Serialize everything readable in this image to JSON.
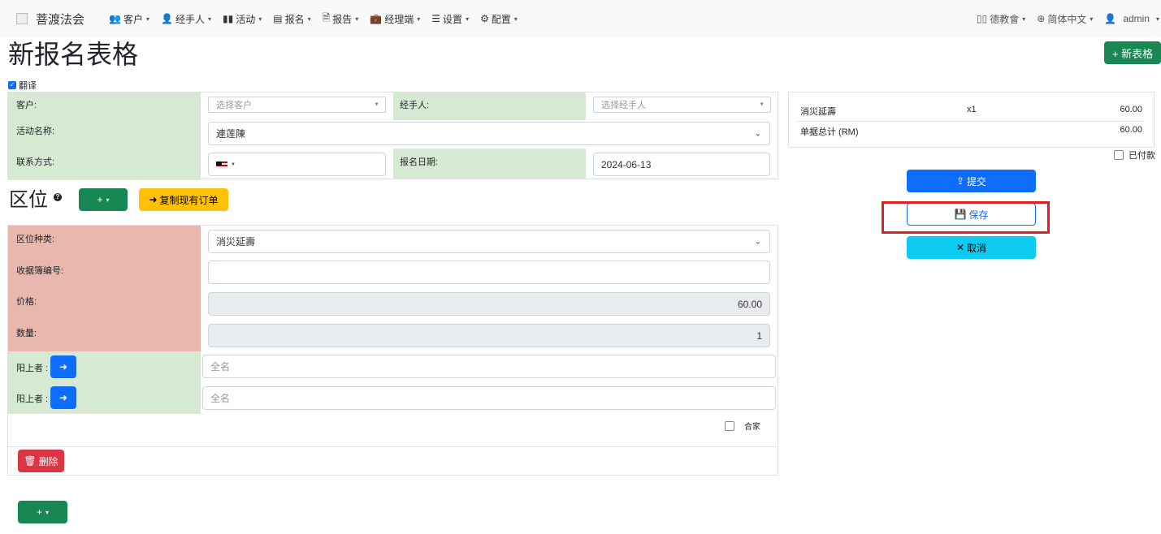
{
  "navbar": {
    "brand": "菩渡法会",
    "items": [
      {
        "icon": "users-icon",
        "glyph": "👥",
        "label": "客户"
      },
      {
        "icon": "user-icon",
        "glyph": "👤",
        "label": "经手人"
      },
      {
        "icon": "book-icon",
        "glyph": "▮▮",
        "label": "活动"
      },
      {
        "icon": "form-icon",
        "glyph": "▤",
        "label": "报名"
      },
      {
        "icon": "report-icon",
        "glyph": "🗎",
        "label": "报告"
      },
      {
        "icon": "briefcase-icon",
        "glyph": "💼",
        "label": "经理端"
      },
      {
        "icon": "sliders-icon",
        "glyph": "☰",
        "label": "设置"
      },
      {
        "icon": "gear-icon",
        "glyph": "⚙",
        "label": "配置"
      }
    ],
    "right": {
      "org_label": "德教會",
      "language_label": "简体中文",
      "user_label": "admin"
    }
  },
  "page": {
    "title": "新报名表格",
    "new_form_label": "+ 新表格",
    "translate_label": "翻译"
  },
  "form": {
    "customer_label": "客户:",
    "customer_placeholder": "选择客户",
    "handler_label": "经手人:",
    "handler_placeholder": "选择经手人",
    "event_label": "活动名称:",
    "event_value": "連莲陳",
    "contact_label": "联系方式:",
    "date_label": "报名日期:",
    "date_value": "2024-06-13"
  },
  "zone": {
    "title": "区位",
    "add_label": "+",
    "copy_label": "复制现有订单",
    "type_label": "区位种类:",
    "type_value": "消災延壽",
    "receipt_label": "收据簿编号:",
    "receipt_value": "",
    "price_label": "价格:",
    "price_value": "60.00",
    "qty_label": "数量:",
    "qty_value": "1",
    "yang_label_1": "阳上者 :",
    "name_placeholder_1": "全名",
    "yang_label_2": "阳上者 :",
    "name_placeholder_2": "全名",
    "family_label": "合家",
    "delete_label": "删除"
  },
  "summary": {
    "item_name": "消災延壽",
    "item_qty": "x1",
    "item_price": "60.00",
    "total_label": "单据总计 (RM)",
    "total_value": "60.00",
    "paid_label": "已付款"
  },
  "actions": {
    "submit_label": "提交",
    "save_label": "保存",
    "cancel_label": "取消"
  },
  "bottom": {
    "add_label": "+"
  }
}
